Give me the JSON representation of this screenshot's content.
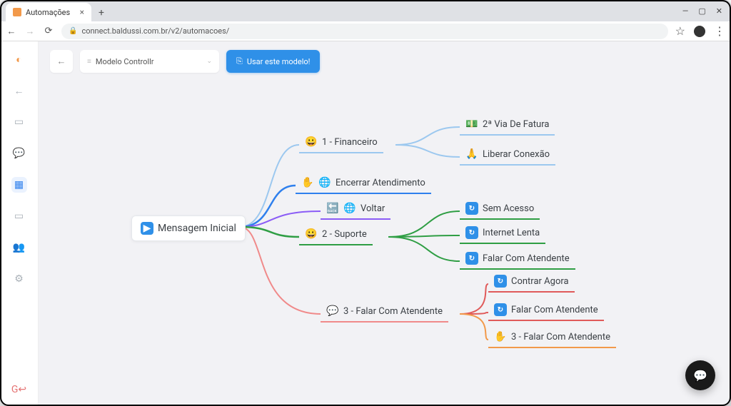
{
  "browser": {
    "tab_title": "Automações",
    "url": "connect.baldussi.com.br/v2/automacoes/"
  },
  "toolbar": {
    "model_label": "Modelo Controllr",
    "use_template_label": "Usar este modelo!"
  },
  "sidebar": {
    "items": [
      {
        "name": "brand",
        "glyph": "◐"
      },
      {
        "name": "back",
        "glyph": "←"
      },
      {
        "name": "page",
        "glyph": "▭"
      },
      {
        "name": "chat",
        "glyph": "💬"
      },
      {
        "name": "dashboard",
        "glyph": "▦"
      },
      {
        "name": "message",
        "glyph": "▭"
      },
      {
        "name": "users",
        "glyph": "👥"
      },
      {
        "name": "settings",
        "glyph": "⚙"
      }
    ],
    "logout_glyph": "G↩"
  },
  "colors": {
    "blue_light": "#9cc8ef",
    "blue_mid": "#2f80ed",
    "green": "#2f9e44",
    "purple": "#8b5cf6",
    "pink": "#f08a8a",
    "red": "#e05a5a",
    "orange": "#f2994a"
  },
  "mindmap": {
    "root": {
      "icon": "play",
      "label": "Mensagem Inicial"
    },
    "branches": [
      {
        "id": "b1",
        "color_key": "blue_light",
        "icon": "😀",
        "label": "1 - Financeiro",
        "children": [
          {
            "id": "b1c1",
            "icon": "💵",
            "label": "2ª Via De Fatura",
            "color_key": "blue_light"
          },
          {
            "id": "b1c2",
            "icon": "🙏",
            "label": "Liberar Conexão",
            "color_key": "blue_light"
          }
        ]
      },
      {
        "id": "b2",
        "color_key": "blue_mid",
        "icon": "✋",
        "icon2": "🌐",
        "label": "Encerrar Atendimento",
        "children": []
      },
      {
        "id": "b3",
        "color_key": "purple",
        "icon": "🔙",
        "icon2": "🌐",
        "label": "Voltar",
        "children": []
      },
      {
        "id": "b4",
        "color_key": "green",
        "icon": "😀",
        "label": "2 - Suporte",
        "children": [
          {
            "id": "b4c1",
            "icon_badge": "↻",
            "label": "Sem Acesso",
            "color_key": "green"
          },
          {
            "id": "b4c2",
            "icon_badge": "↻",
            "label": "Internet Lenta",
            "color_key": "green"
          },
          {
            "id": "b4c3",
            "icon_badge": "↻",
            "label": "Falar Com Atendente",
            "color_key": "green"
          }
        ]
      },
      {
        "id": "b5",
        "color_key": "pink",
        "icon": "💬",
        "label": "3 - Falar Com Atendente",
        "children": [
          {
            "id": "b5c1",
            "icon_badge": "↻",
            "label": "Contrar Agora",
            "color_key": "red"
          },
          {
            "id": "b5c2",
            "icon_badge": "↻",
            "label": "Falar Com Atendente",
            "color_key": "red"
          },
          {
            "id": "b5c3",
            "icon": "✋",
            "label": "3 - Falar Com Atendente",
            "color_key": "orange"
          }
        ]
      }
    ]
  }
}
